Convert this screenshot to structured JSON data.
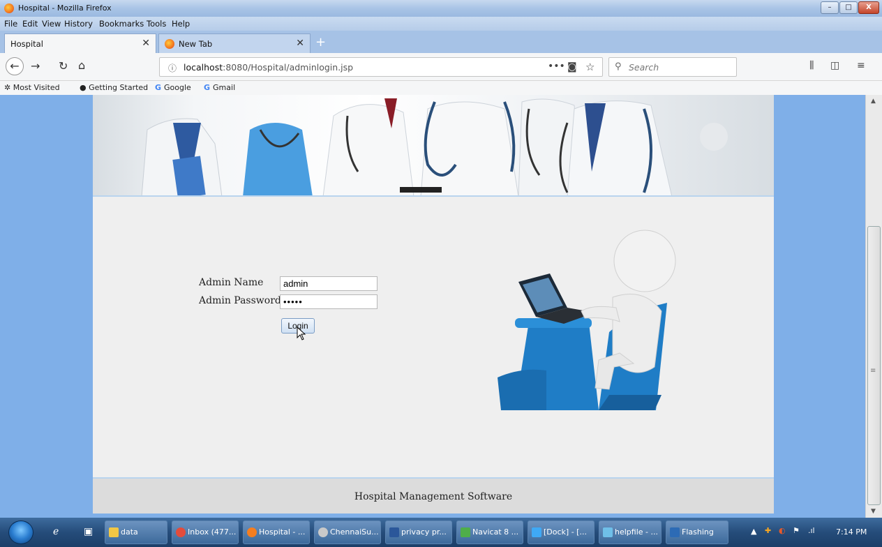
{
  "window": {
    "title": "Hospital - Mozilla Firefox",
    "controls": {
      "minimize": "–",
      "maximize": "□",
      "close": "X"
    }
  },
  "menu": [
    "File",
    "Edit",
    "View",
    "History",
    "Bookmarks",
    "Tools",
    "Help"
  ],
  "tabs": [
    {
      "label": "Hospital",
      "active": true
    },
    {
      "label": "New Tab",
      "active": false
    }
  ],
  "toolbar": {
    "address_prefix": "localhost",
    "address_rest": ":8080/Hospital/adminlogin.jsp",
    "search_placeholder": "Search"
  },
  "bookmarks": [
    "Most Visited",
    "Getting Started",
    "Google",
    "Gmail"
  ],
  "login": {
    "name_label": "Admin Name",
    "name_value": "admin",
    "password_label": "Admin Password",
    "password_value": "•••••",
    "button_label": "Login"
  },
  "footer": {
    "text": "Hospital Management Software"
  },
  "taskbar": {
    "items": [
      "data",
      "Inbox (477...",
      "Hospital - ...",
      "ChennaiSu...",
      "privacy pr...",
      "Navicat 8 ...",
      "[Dock] - [...",
      "helpfile - ...",
      "Flashing"
    ],
    "clock": "7:14 PM"
  },
  "colors": {
    "page_background": "#7fafe8",
    "panel": "#efefef",
    "footer": "#dcdcdc",
    "chair_blue": "#1f7dc6"
  }
}
